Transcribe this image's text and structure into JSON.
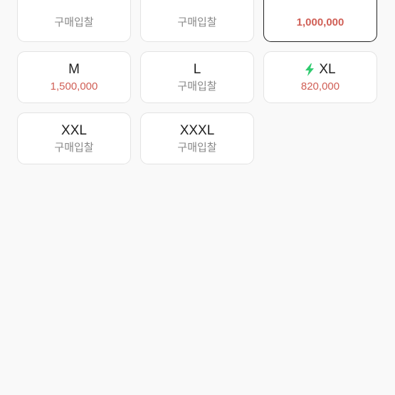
{
  "accent_colors": {
    "price": "#d05f56",
    "bolt": "#2fcb6f",
    "selected_border": "#222222"
  },
  "sizes": [
    {
      "name": "",
      "price": "구매입찰",
      "has_price": false,
      "selected": false
    },
    {
      "name": "",
      "price": "구매입찰",
      "has_price": false,
      "selected": false
    },
    {
      "name": "",
      "price": "1,000,000",
      "has_price": true,
      "selected": true
    },
    {
      "name": "M",
      "price": "1,500,000",
      "has_price": true,
      "selected": false
    },
    {
      "name": "L",
      "price": "구매입찰",
      "has_price": false,
      "selected": false
    },
    {
      "name": "XL",
      "price": "820,000",
      "has_price": true,
      "selected": false,
      "icon": "lightning-icon"
    },
    {
      "name": "XXL",
      "price": "구매입찰",
      "has_price": false,
      "selected": false
    },
    {
      "name": "XXXL",
      "price": "구매입찰",
      "has_price": false,
      "selected": false
    }
  ]
}
